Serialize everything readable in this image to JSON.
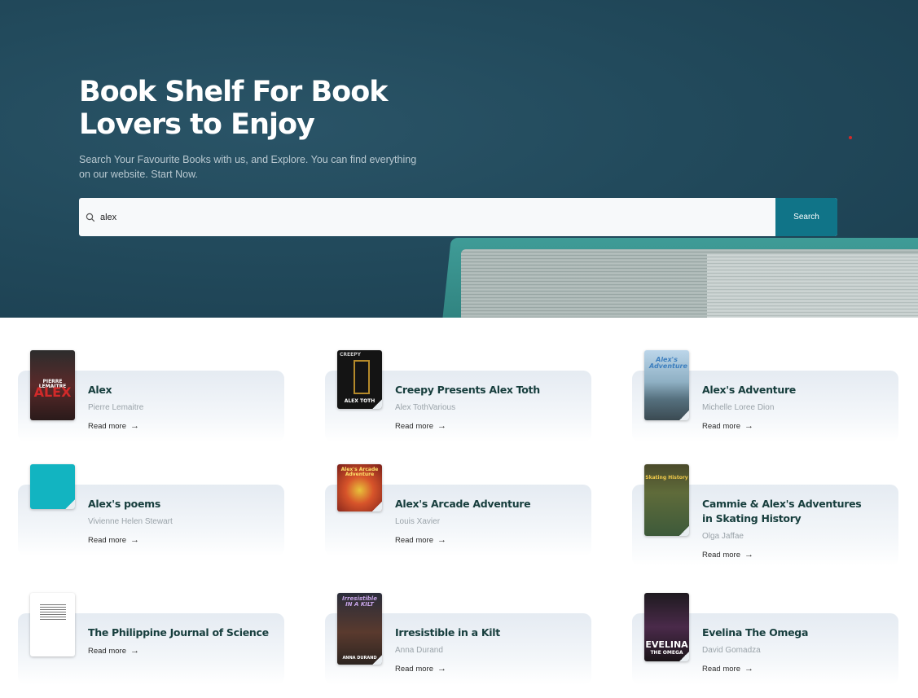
{
  "hero": {
    "title": "Book Shelf For Book Lovers to Enjoy",
    "subtitle": "Search Your Favourite Books with us, and Explore. You can find everything on our website. Start Now."
  },
  "search": {
    "value": "alex",
    "button_label": "Search",
    "icon": "search-icon"
  },
  "colors": {
    "accent": "#107488",
    "hero_bg": "#224a5c",
    "card_title": "#173e3d"
  },
  "results": [
    {
      "title": "Alex",
      "author": "Pierre Lemaitre",
      "link": "Read more",
      "cover_text": "ALEX",
      "cover_top": "PIERRE LEMAITRE"
    },
    {
      "title": "Creepy Presents Alex Toth",
      "author": "Alex TothVarious",
      "link": "Read more",
      "cover_text": "ALEX TOTH",
      "cover_top": "CREEPY"
    },
    {
      "title": "Alex's Adventure",
      "author": "Michelle Loree Dion",
      "link": "Read more",
      "cover_text": "Alex's Adventure"
    },
    {
      "title": "Alex's poems",
      "author": "Vivienne Helen Stewart",
      "link": "Read more"
    },
    {
      "title": "Alex's Arcade Adventure",
      "author": "Louis Xavier",
      "link": "Read more",
      "cover_text": "Alex's Arcade Adventure"
    },
    {
      "title": "Cammie & Alex's Adventures in Skating History",
      "author": "Olga Jaffae",
      "link": "Read more",
      "cover_text": "Skating History"
    },
    {
      "title": "The Philippine Journal of Science",
      "author": "",
      "link": "Read more"
    },
    {
      "title": "Irresistible in a Kilt",
      "author": "Anna Durand",
      "link": "Read more",
      "cover_text": "Irresistible IN A KILT",
      "cover_bottom": "ANNA DURAND"
    },
    {
      "title": "Evelina The Omega",
      "author": "David Gomadza",
      "link": "Read more",
      "cover_text": "EVELINA",
      "cover_bottom": "THE OMEGA"
    }
  ]
}
